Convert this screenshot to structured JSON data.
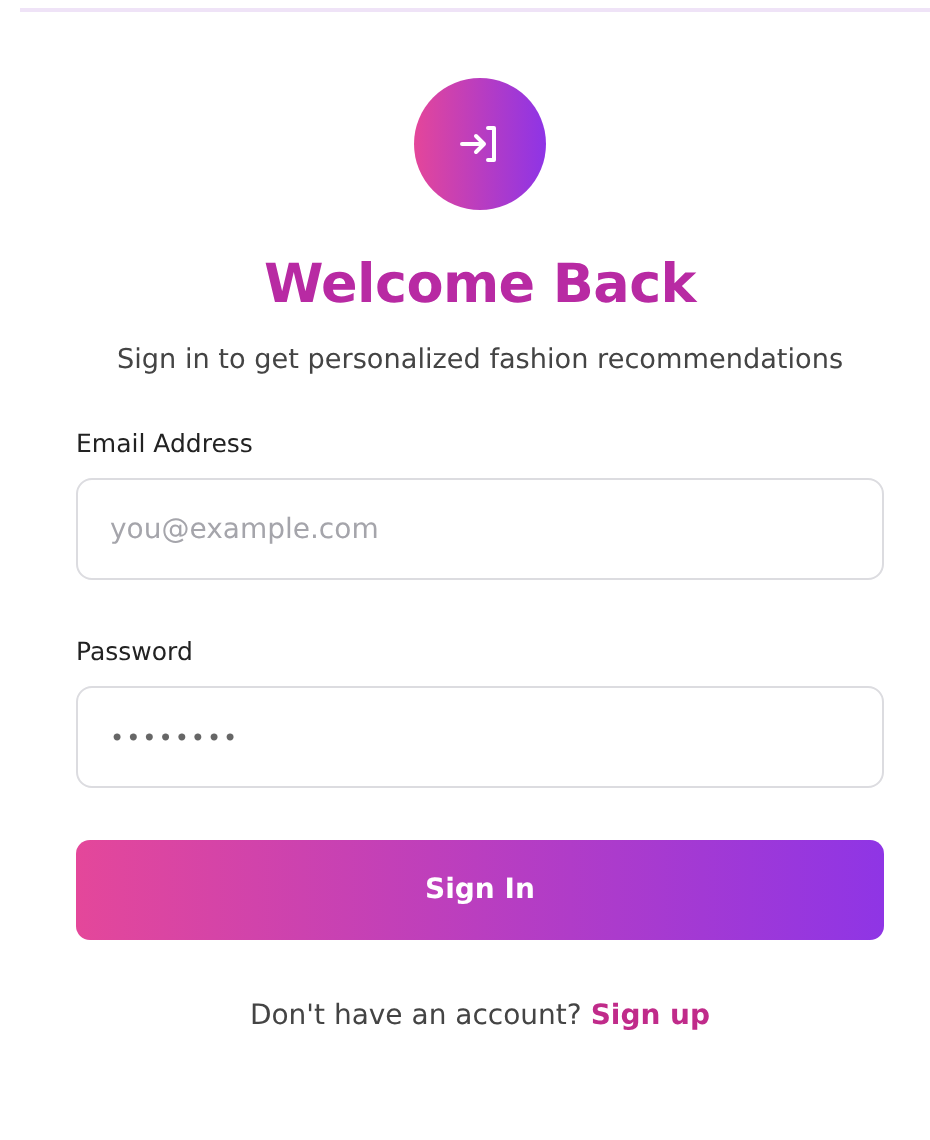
{
  "title": "Welcome Back",
  "subtitle": "Sign in to get personalized fashion recommendations",
  "fields": [
    {
      "label": "Email Address",
      "kind": "email",
      "placeholder": "you@example.com"
    },
    {
      "label": "Password",
      "kind": "password",
      "value": "••••••••"
    }
  ],
  "submit": "Sign In",
  "footer": {
    "text": "Don't have an account?",
    "link": "Sign up"
  }
}
